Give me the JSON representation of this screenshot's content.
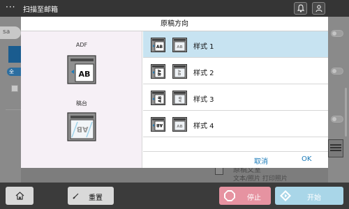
{
  "topbar": {
    "menu_glyph": "···",
    "title": "扫描至邮箱",
    "icons": [
      "bell-icon",
      "user-icon"
    ]
  },
  "background": {
    "search_placeholder": "sa",
    "all_tab": "全",
    "doc_title": "原稿文室",
    "doc_subtitle": "文本/照片 打印照片"
  },
  "dialog": {
    "title": "原稿方向",
    "left_panel": {
      "adf_label": "ADF",
      "platen_label": "稿台"
    },
    "options": [
      {
        "label": "样式 1",
        "selected": true
      },
      {
        "label": "样式 2",
        "selected": false
      },
      {
        "label": "样式 3",
        "selected": false
      },
      {
        "label": "样式 4",
        "selected": false
      }
    ],
    "cancel_label": "取消",
    "ok_label": "OK"
  },
  "bottombar": {
    "reset_label": "重置",
    "stop_label": "停止",
    "start_label": "开始"
  },
  "colors": {
    "accent": "#1a7ab8",
    "selected_row": "#c7e3f1",
    "left_panel_bg": "#f6f0f6",
    "stop": "#e693a1",
    "start": "#a9d6e8",
    "topbar": "#353535"
  }
}
